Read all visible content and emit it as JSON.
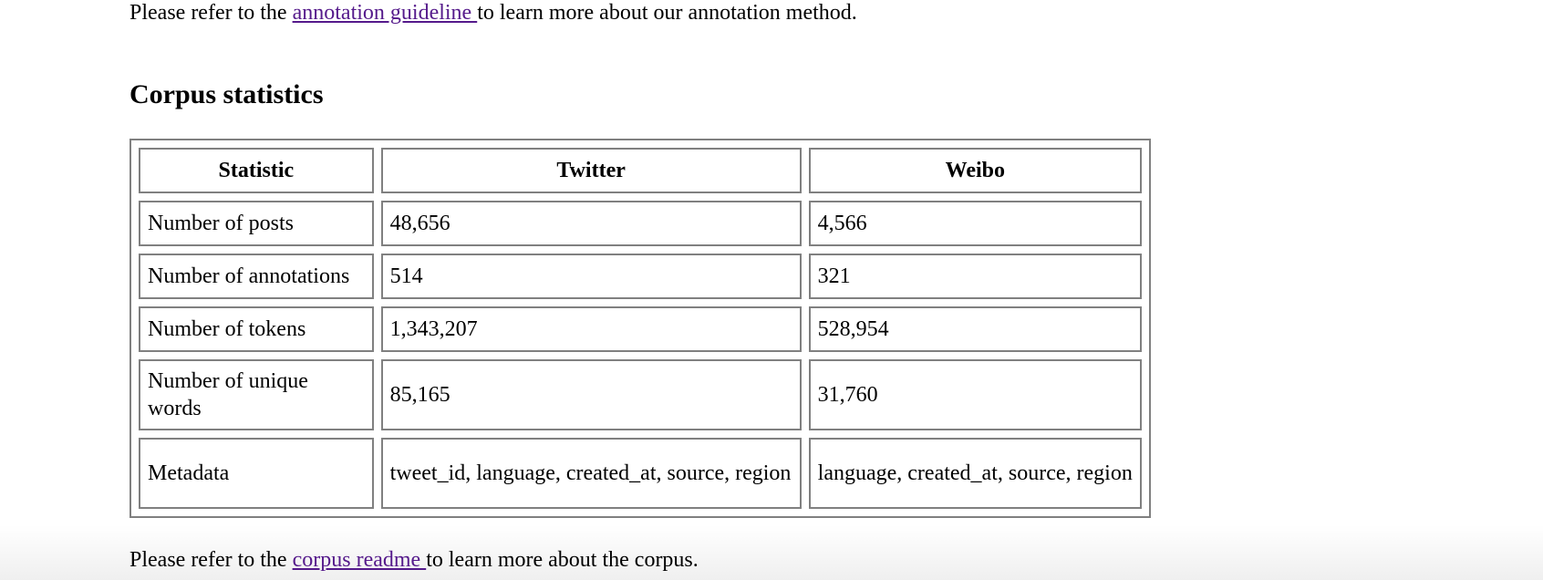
{
  "intro": {
    "prefix": "Please refer to the ",
    "link": "annotation guideline ",
    "suffix": "to learn more about our annotation method."
  },
  "section_title": "Corpus statistics",
  "table": {
    "headers": [
      "Statistic",
      "Twitter",
      "Weibo"
    ],
    "rows": [
      [
        "Number of posts",
        "48,656",
        "4,566"
      ],
      [
        "Number of annotations",
        "514",
        "321"
      ],
      [
        "Number of tokens",
        "1,343,207",
        "528,954"
      ],
      [
        "Number of unique words",
        "85,165",
        "31,760"
      ],
      [
        "Metadata",
        "tweet_id, language, created_at, source, region",
        "language, created_at, source, region"
      ]
    ]
  },
  "outro": {
    "prefix": "Please refer to the ",
    "link": "corpus readme ",
    "suffix": "to learn more about the corpus."
  },
  "colors": {
    "link": "#551a8b",
    "border": "#808080"
  }
}
